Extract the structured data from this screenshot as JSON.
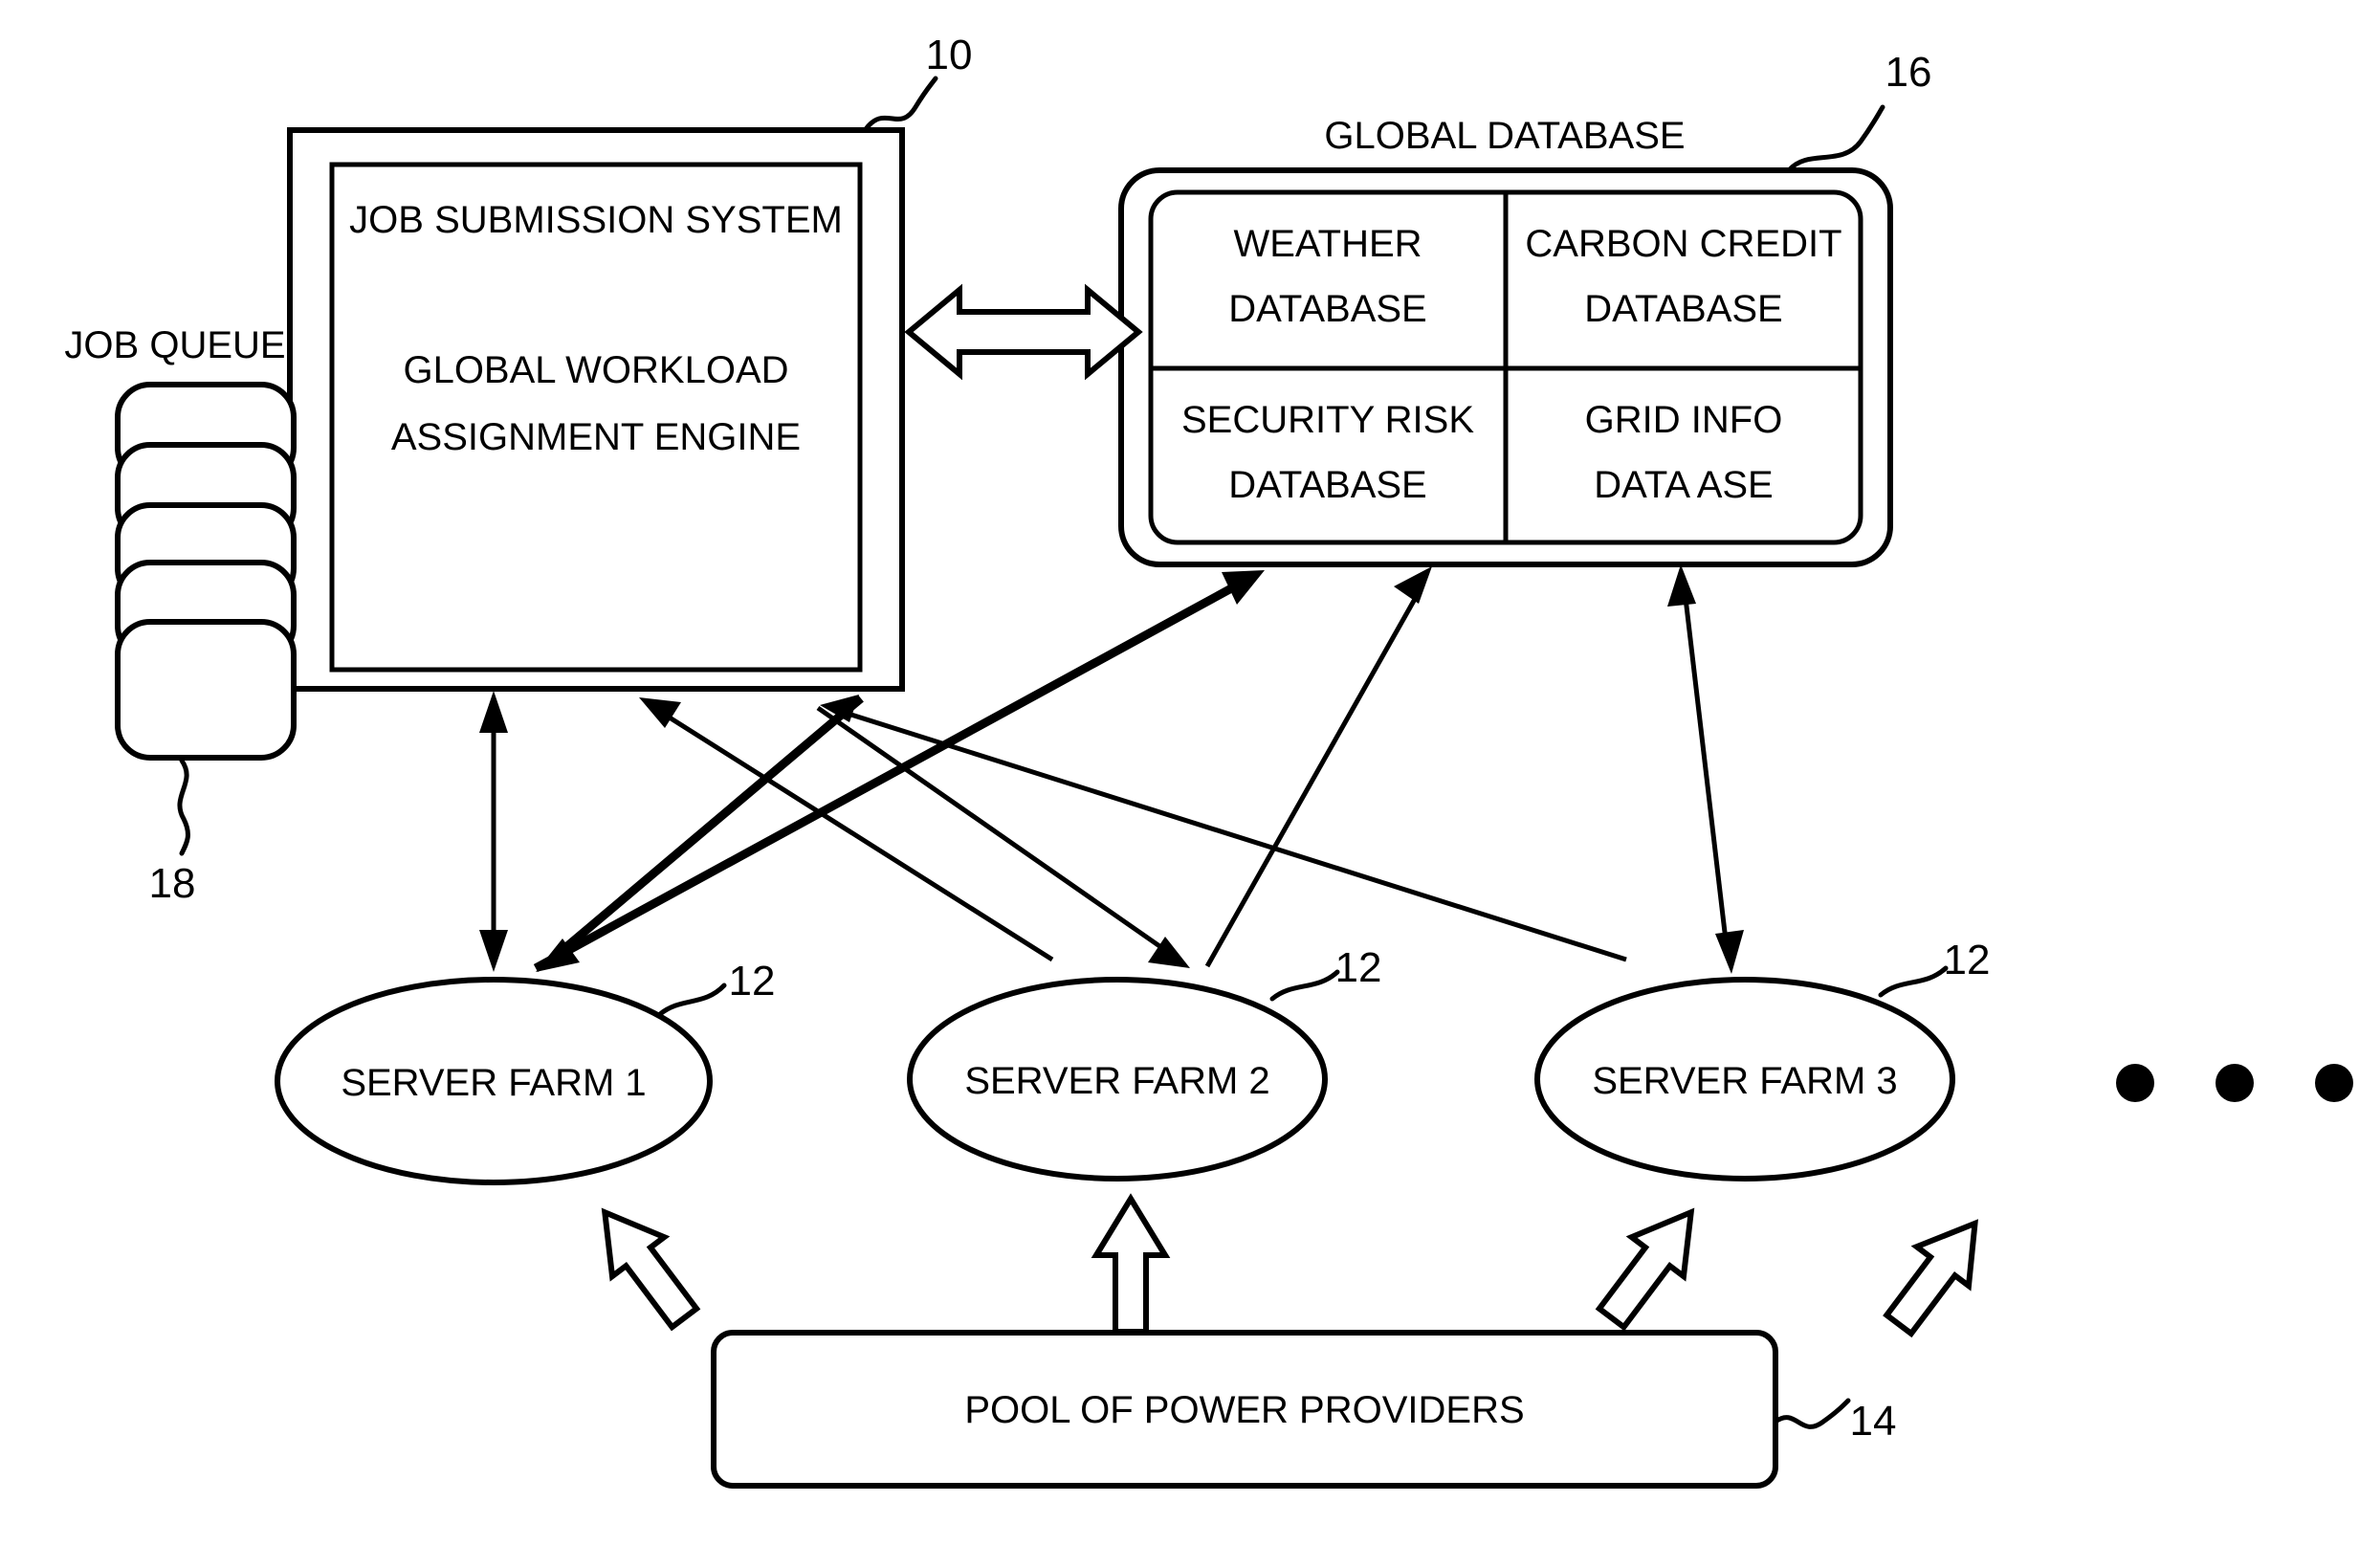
{
  "figure": {
    "job_submission": {
      "line1": "JOB SUBMISSION SYSTEM",
      "line2": "GLOBAL WORKLOAD",
      "line3": "ASSIGNMENT ENGINE",
      "ref": "10"
    },
    "job_queue": {
      "label": "JOB QUEUE",
      "ref": "18",
      "segments": 5
    },
    "global_database": {
      "title": "GLOBAL DATABASE",
      "ref": "16",
      "cells": [
        {
          "line1": "WEATHER",
          "line2": "DATABASE"
        },
        {
          "line1": "CARBON CREDIT",
          "line2": "DATABASE"
        },
        {
          "line1": "SECURITY RISK",
          "line2": "DATABASE"
        },
        {
          "line1": "GRID INFO",
          "line2": "DATA ASE"
        }
      ]
    },
    "server_farms": [
      {
        "label": "SERVER FARM 1",
        "ref": "12"
      },
      {
        "label": "SERVER FARM 2",
        "ref": "12"
      },
      {
        "label": "SERVER FARM 3",
        "ref": "12"
      }
    ],
    "ellipsis": "• • •",
    "power_pool": {
      "label": "POOL OF POWER PROVIDERS",
      "ref": "14"
    },
    "colors": {
      "stroke": "#000000",
      "background": "#ffffff"
    }
  }
}
